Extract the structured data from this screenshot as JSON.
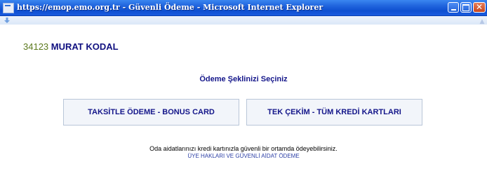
{
  "window": {
    "title": "https://emop.emo.org.tr - Güvenli Ödeme - Microsoft Internet Explorer",
    "close_glyph": "✕"
  },
  "member": {
    "number": "34123",
    "name": "MURAT KODAL"
  },
  "main": {
    "heading": "Ödeme Şeklinizi Seçiniz",
    "buttons": [
      {
        "label": "TAKSİTLE ÖDEME - BONUS CARD"
      },
      {
        "label": "TEK ÇEKİM - TÜM KREDİ KARTLARI"
      }
    ],
    "info_text": "Oda aidatlarınızı kredi kartınızla güvenli bir ortamda ödeyebilirsiniz.",
    "link_text": "ÜYE HAKLARI VE GÜVENLİ AİDAT ÖDEME"
  },
  "colors": {
    "titlebar": "#0e4fd0",
    "member_number": "#5c7a1e",
    "member_name": "#101080",
    "button_text": "#14168a",
    "link": "#2c3fa6"
  },
  "icons": [
    "ie-window-icon",
    "minimize-icon",
    "maximize-icon",
    "close-icon",
    "down-arrow-icon",
    "scroll-up-icon"
  ]
}
